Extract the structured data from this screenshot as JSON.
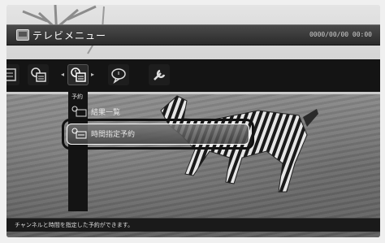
{
  "window": {
    "title": "テレビメニュー",
    "clock": "0000/00/00 00:00"
  },
  "toolbar": {
    "icons": [
      "program-guide-icon",
      "timer-icon",
      "info-icon",
      "wrench-icon"
    ],
    "selected_label": "予約"
  },
  "menu": {
    "items": [
      {
        "label": "結果一覧",
        "icon": "list-icon"
      },
      {
        "label": "時間指定予約",
        "icon": "timer-reservation-icon"
      }
    ]
  },
  "status": {
    "text": "チャンネルと時間を指定した予約ができます。"
  },
  "colors": {
    "bar": "#141414",
    "highlight_outline": "#111111",
    "text": "#e8e8e8"
  }
}
